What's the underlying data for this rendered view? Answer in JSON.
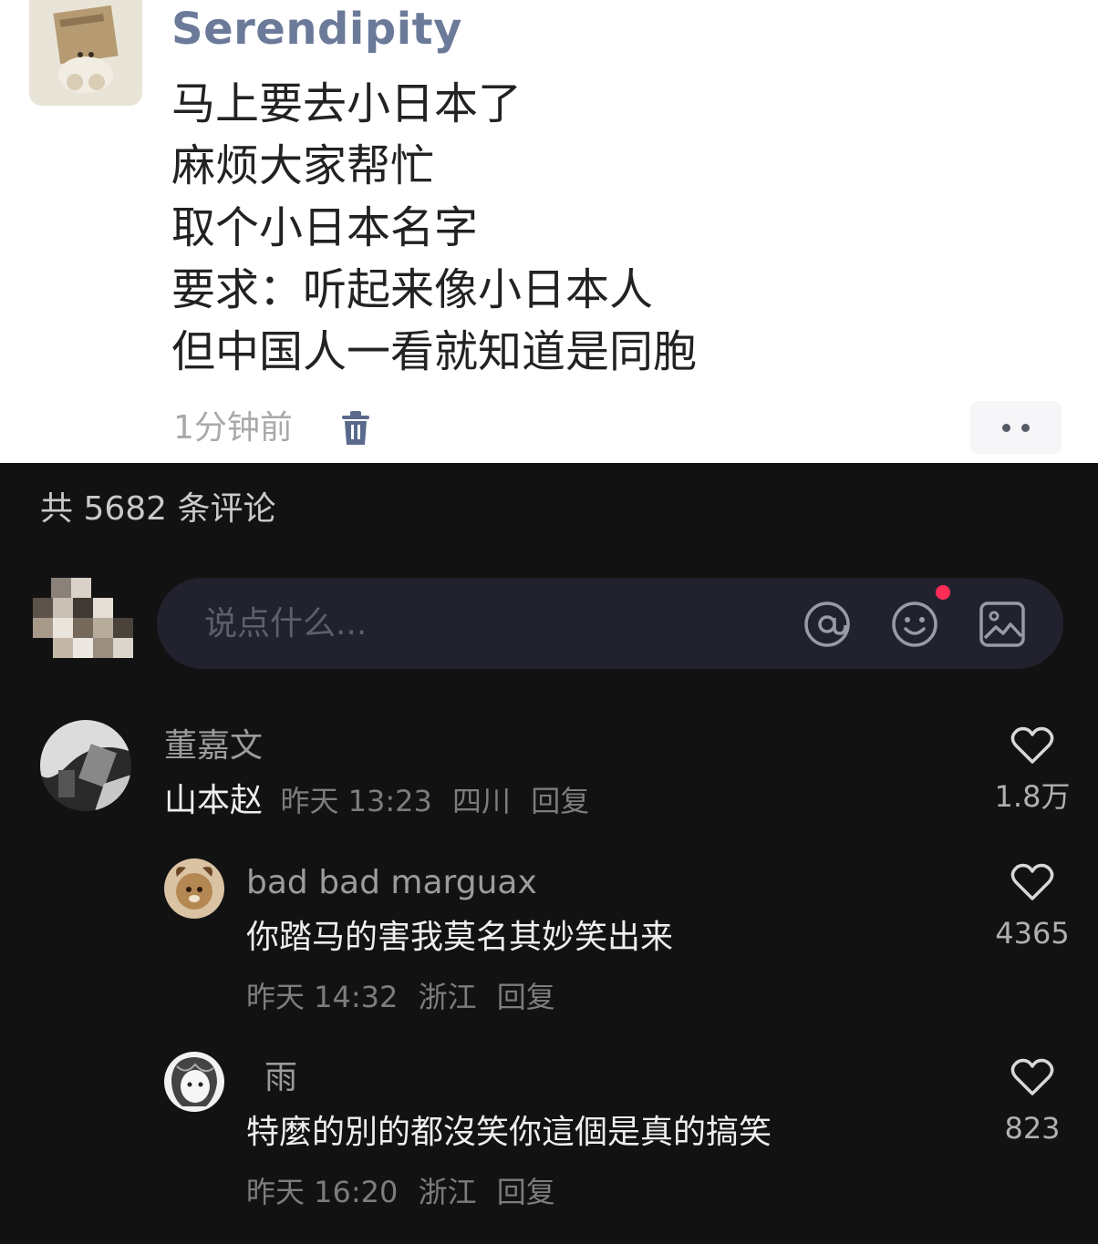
{
  "post": {
    "username": "Serendipity",
    "lines": [
      "马上要去小日本了",
      "麻烦大家帮忙",
      "取个小日本名字",
      "要求：听起来像小日本人",
      "但中国人一看就知道是同胞"
    ],
    "time": "1分钟前",
    "icons": {
      "delete": "trash-icon",
      "more": "more-dots-icon"
    }
  },
  "comments_header": {
    "count_text": "共 5682 条评论"
  },
  "input": {
    "placeholder": "说点什么...",
    "icons": [
      "at-icon",
      "emoji-icon",
      "image-icon"
    ]
  },
  "comments": [
    {
      "name": "董嘉文",
      "text": "山本赵",
      "date": "昨天 13:23",
      "location": "四川",
      "reply": "回复",
      "likes": "1.8万"
    },
    {
      "name": "bad bad marguax",
      "text": "你踏马的害我莫名其妙笑出来",
      "date": "昨天 14:32",
      "location": "浙江",
      "reply": "回复",
      "likes": "4365"
    },
    {
      "name": "雨",
      "text": "特麼的別的都沒笑你這個是真的搞笑",
      "date": "昨天 16:20",
      "location": "浙江",
      "reply": "回复",
      "likes": "823"
    }
  ],
  "colors": {
    "post_bg": "#ffffff",
    "username": "#6b7a99",
    "comments_bg": "#121212",
    "input_bg": "#22222e",
    "notify_dot": "#ff2d55"
  }
}
